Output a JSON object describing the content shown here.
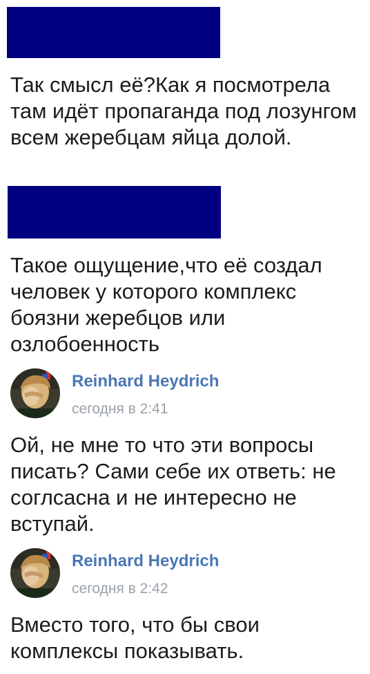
{
  "comments": [
    {
      "author": "",
      "time": "",
      "text": "Так смысл её?Как я посмотрела там идёт пропаганда под лозунгом всем жеребцам яйца долой.",
      "author_redacted": true
    },
    {
      "author": "",
      "time": "",
      "text": "Такое ощущение,что её создал человек у которого комплекс боязни жеребцов или озлобоенность",
      "author_redacted": true
    },
    {
      "author": "Reinhard Heydrich",
      "time": "сегодня в 2:41",
      "text": "Ой, не мне то что эти вопросы писать? Сами себе их ответь: не соглсасна и не интересно не вступай.",
      "avatar": "user-avatar-photo"
    },
    {
      "author": "Reinhard Heydrich",
      "time": "сегодня в 2:42",
      "text": "Вместо того, что бы свои комплексы показывать.",
      "avatar": "user-avatar-photo"
    }
  ],
  "colors": {
    "redaction": "#000080",
    "author_name": "#4a77b4",
    "timestamp": "#9aa1a9",
    "message_text": "#1c1c1c"
  }
}
